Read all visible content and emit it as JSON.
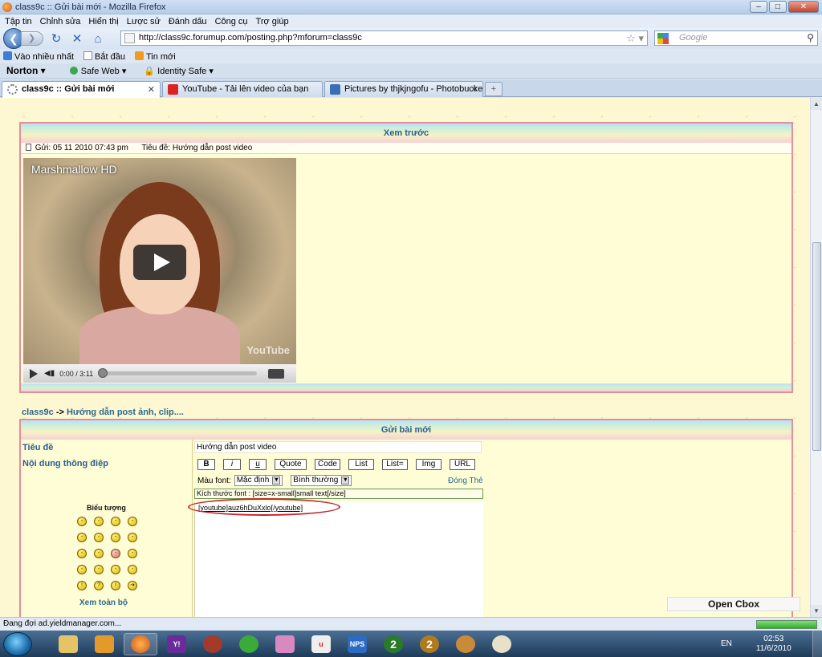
{
  "window": {
    "title": "class9c :: Gửi bài mới - Mozilla Firefox",
    "min": "–",
    "max": "□",
    "close": "✕"
  },
  "menu": [
    "Tập tin",
    "Chỉnh sửa",
    "Hiển thị",
    "Lược sử",
    "Đánh dấu",
    "Công cụ",
    "Trợ giúp"
  ],
  "nav": {
    "url": "http://class9c.forumup.com/posting.php?mforum=class9c",
    "search_placeholder": "Google",
    "back_icon": "back-arrow-icon",
    "forward_icon": "forward-arrow-icon",
    "reload_icon": "reload-icon",
    "stop_icon": "stop-icon",
    "home_icon": "home-icon"
  },
  "bookmarks": [
    "Vào nhiều nhất",
    "Bắt đầu",
    "Tin mới"
  ],
  "norton": {
    "logo": "Norton",
    "safe_web": "Safe Web",
    "identity_safe": "Identity Safe"
  },
  "tabs": [
    {
      "label": "class9c :: Gửi bài mới",
      "active": true
    },
    {
      "label": "YouTube - Tải lên video của bạn",
      "active": false
    },
    {
      "label": "Pictures by thjkjngofu - Photobucket",
      "active": false
    }
  ],
  "preview": {
    "heading": "Xem trước",
    "meta_posted": "Gửi: 05 11 2010 07:43 pm",
    "meta_subject": "Tiêu đề: Hướng dẫn post video",
    "video": {
      "title": "Marshmallow HD",
      "time": "0:00 / 3:11",
      "watermark": "YouTube",
      "progress": 0
    }
  },
  "breadcrumb": {
    "forum": "class9c",
    "separator": "->",
    "topic": "Hướng dẫn post ảnh, clip...."
  },
  "form": {
    "heading": "Gửi bài mới",
    "subject_label": "Tiêu đề",
    "subject_value": "Hướng dẫn post video",
    "message_label": "Nội dung thông điệp",
    "bbcode_buttons": [
      "B",
      "i",
      "u",
      "Quote",
      "Code",
      "List",
      "List=",
      "Img",
      "URL"
    ],
    "close_tags": "Đóng Thẻ",
    "font_color_label": "Màu font:",
    "font_color_value": "Mặc định",
    "font_size_value": "Bình thường",
    "help_line": "Kích thước font : [size=x-small]small text[/size]",
    "message_value": "[youtube]auz6hDuXxlo[/youtube]",
    "emoticons_title": "Biểu tượng",
    "emoticons_view_all": "Xem toàn bộ"
  },
  "cbox": "Open Cbox",
  "status": {
    "text": "Đang đợi ad.yieldmanager.com...",
    "progress": 1.0
  },
  "taskbar": {
    "apps": [
      "explorer",
      "media-player",
      "firefox",
      "yahoo-messenger",
      "app-5",
      "app-6",
      "game-avatar",
      "unikey",
      "NPS",
      "2",
      "2",
      "game-icon",
      "paint"
    ],
    "lang": "EN",
    "time": "02:53",
    "date": "11/6/2010"
  }
}
